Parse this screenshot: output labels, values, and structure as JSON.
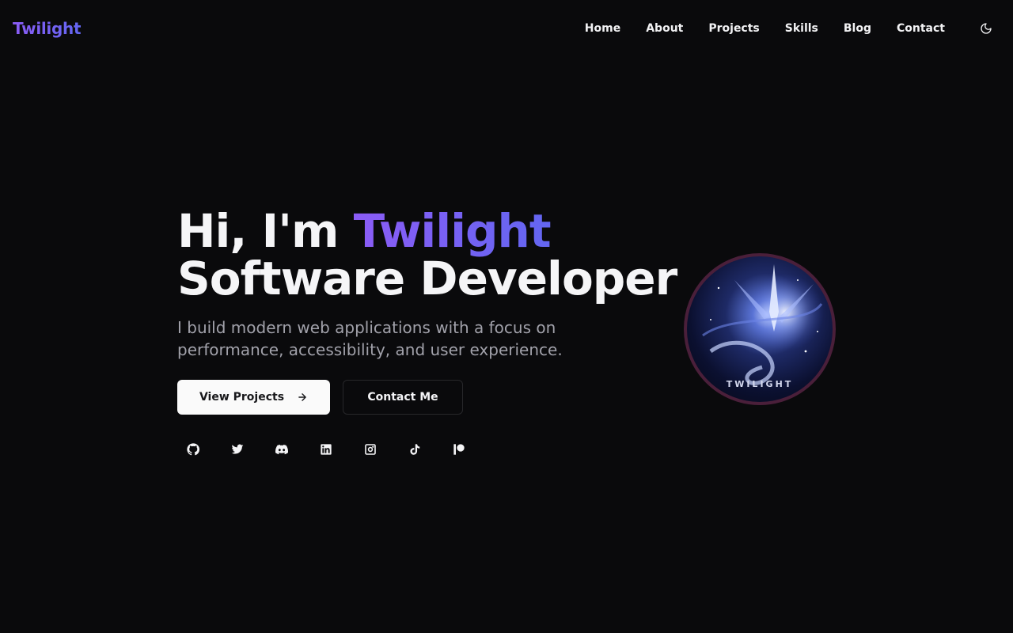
{
  "header": {
    "logo": "Twilight",
    "nav": [
      "Home",
      "About",
      "Projects",
      "Skills",
      "Blog",
      "Contact"
    ],
    "theme_toggle_icon": "moon-icon"
  },
  "hero": {
    "greeting_prefix": "Hi, I'm ",
    "name": "Twilight",
    "role": "Software Developer",
    "subtitle": "I build modern web applications with a focus on performance, accessibility, and user experience.",
    "primary_button": "View Projects",
    "secondary_button": "Contact Me",
    "socials": [
      "github-icon",
      "twitter-icon",
      "discord-icon",
      "linkedin-icon",
      "instagram-icon",
      "tiktok-icon",
      "patreon-icon"
    ]
  },
  "avatar": {
    "caption": "TWILIGHT"
  },
  "colors": {
    "background": "#0a0a0c",
    "accent_start": "#8b5cf6",
    "accent_end": "#6366f1",
    "muted_text": "#a1a1aa",
    "avatar_border": "#4a1f3a"
  }
}
